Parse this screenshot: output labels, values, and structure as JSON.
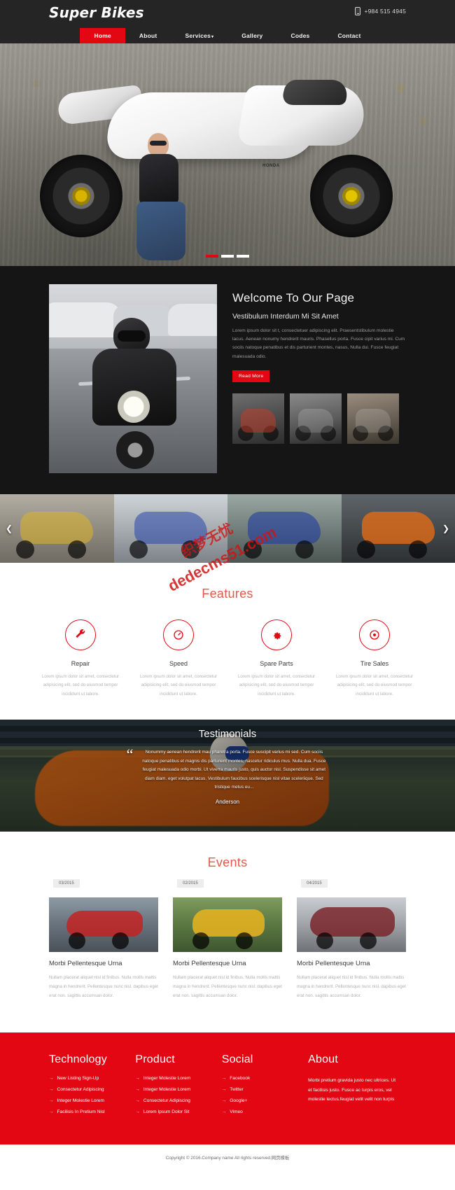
{
  "header": {
    "logo": "Super Bikes",
    "phone": "+984 515 4945",
    "phone_icon": "mobile-phone-icon",
    "nav": [
      {
        "label": "Home",
        "active": true
      },
      {
        "label": "About",
        "active": false
      },
      {
        "label": "Services",
        "active": false,
        "caret": "▾"
      },
      {
        "label": "Gallery",
        "active": false
      },
      {
        "label": "Codes",
        "active": false
      },
      {
        "label": "Contact",
        "active": false
      }
    ]
  },
  "hero": {
    "slides": 3,
    "active_slide": 1,
    "badge": "HONDA"
  },
  "welcome": {
    "title": "Welcome To Our Page",
    "subtitle": "Vestibulum Interdum Mi Sit Amet",
    "paragraph": "Lorem ipsum dolor sit t, consectetuer adipiscing elit. Praesentstibulum molestie lacus. Aenean nonumy hendrerit mauris. Phasellus porta. Fusce cipit varius mi. Cum sociis natoque penatibus et dis parturient montes, nasus, Nulla dui. Fusce feugiat malesuada odio.",
    "read_more": "Read More"
  },
  "gallery": {
    "prev_icon": "chevron-left-icon",
    "next_icon": "chevron-right-icon",
    "watermark": "dedecms51.com",
    "watermark_cn": "织梦无忧"
  },
  "features": {
    "title": "Features",
    "items": [
      {
        "name": "Repair",
        "icon": "wrench-icon",
        "desc": "Lorem ipsum dolor sit amet, consectetur adipisicing elit, sed do eiusmod tempor incididunt ut labore."
      },
      {
        "name": "Speed",
        "icon": "speedometer-icon",
        "desc": "Lorem ipsum dolor sit amet, consectetur adipisicing elit, sed do eiusmod tempor incididunt ut labore."
      },
      {
        "name": "Spare Parts",
        "icon": "gear-icon",
        "desc": "Lorem ipsum dolor sit amet, consectetur adipisicing elit, sed do eiusmod tempor incididunt ut labore."
      },
      {
        "name": "Tire Sales",
        "icon": "tire-target-icon",
        "desc": "Lorem ipsum dolor sit amet, consectetur adipisicing elit, sed do eiusmod tempor incididunt ut labore."
      }
    ]
  },
  "testimonials": {
    "title": "Testimonials",
    "quote_mark": "“",
    "text": "Nonummy aenean hendrerit mau pharetra porta. Fusce suscipit varius mi sed. Cum sociis natoque penatibus et magnis dis parturient montes, nascetur ridiculus mus. Nulla dua. Fusce feugiat malesuada odio morbi. Ut viverra mauris justo, quis auctor nisl. Suspendisse sit amet diam diam. eget volutpat lacus. Vestibulum faucibus scelerisque nisl vitae sceleriique. Sed tristique metus eu...",
    "author": "Anderson"
  },
  "events": {
    "title": "Events",
    "cards": [
      {
        "date": "03/2015",
        "title": "Morbi Pellentesque Urna",
        "desc": "Nullam placerat aliquet nisl id finibus. Nulla mollis mattis magna in hendrerit. Pellentesque nunc nisl. dapibus eget erat non. sagittis accumsan dolor."
      },
      {
        "date": "02/2015",
        "title": "Morbi Pellentesque Urna",
        "desc": "Nullam placerat aliquet nisl id finibus. Nulla mollis mattis magna in hendrerit. Pellentesque nunc nisl. dapibus eget erat non. sagittis accumsan dolor."
      },
      {
        "date": "04/2015",
        "title": "Morbi Pellentesque Urna",
        "desc": "Nullam placerat aliquet nisl id finibus. Nulla mollis mattis magna in hendrerit. Pellentesque nunc nisl. dapibus eget erat non. sagittis accumsan dolor."
      }
    ]
  },
  "footer": {
    "columns": [
      {
        "heading": "Technology",
        "links": [
          "New Listing Sign-Up",
          "Consectetur Adipiscing",
          "Integer Molestie Lorem",
          "Facilisis In Pretium Nisl"
        ]
      },
      {
        "heading": "Product",
        "links": [
          "Integer Molestie Lorem",
          "Integer Molestie Lorem",
          "Consectetur Adipiscing",
          "Lorem Ipsum Dolor Sit"
        ]
      },
      {
        "heading": "Social",
        "links": [
          "Facebook",
          "Twitter",
          "Google+",
          "Vimeo"
        ]
      }
    ],
    "about": {
      "heading": "About",
      "text": "Morbi pretium gravida justo nec ultrices. Ut et facilisis justo. Fusce ac turpis eros, vel molestie lectus.feugiat velit velit non turpis"
    },
    "arrow_icon": "→"
  },
  "copyright": {
    "text": "Copyright © 2016.Company name All rights reserved.网页模板"
  },
  "colors": {
    "brand_red": "#e30613",
    "header_dark": "#252525",
    "welcome_dark": "#151515",
    "title_red": "#e35a4a"
  }
}
